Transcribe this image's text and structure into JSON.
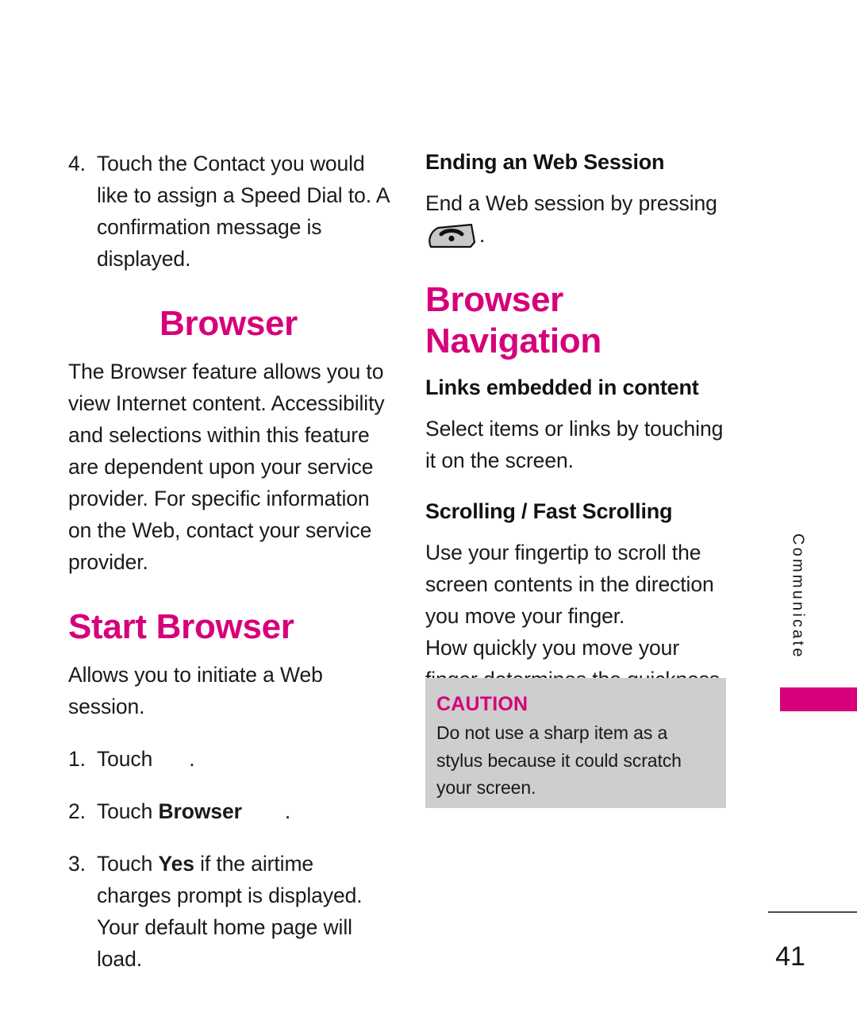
{
  "document": {
    "page_number": "41",
    "side_tab_label": "Communicate",
    "accent_color": "#d6007a",
    "caution_bg_color": "#cecece"
  },
  "left_column": {
    "step4": {
      "number": "4.",
      "text": "Touch the Contact you would like to assign a Speed Dial to. A confirmation message is displayed."
    },
    "browser_title": "Browser",
    "browser_intro": "The Browser feature allows you to view Internet content. Accessibility and selections within this feature are dependent upon your service provider. For specific information on the Web, contact your service provider.",
    "start_browser_title": "Start Browser",
    "start_browser_intro": "Allows you to initiate a Web session.",
    "steps": [
      {
        "number": "1.",
        "prefix": "Touch",
        "bold": "",
        "icon": "menu-key-icon",
        "suffix": "."
      },
      {
        "number": "2.",
        "prefix": "Touch",
        "bold": "Browser",
        "icon": "browser-key-icon",
        "suffix": "."
      },
      {
        "number": "3.",
        "prefix": "Touch",
        "bold": "Yes",
        "icon": "",
        "suffix": "if the airtime charges prompt is displayed. Your default home page will load."
      }
    ]
  },
  "right_column": {
    "ending_session_heading": "Ending an Web Session",
    "ending_session_text_before_icon": "End a Web session by pressing",
    "ending_session_icon": "end-call-key-icon",
    "ending_session_text_after_icon": ".",
    "browser_navigation_title": "Browser Navigation",
    "links_heading": "Links embedded in content",
    "links_text": "Select items or links by touching it on the screen.",
    "scrolling_heading": "Scrolling / Fast Scrolling",
    "scrolling_paragraph_1": "Use your fingertip to scroll the screen contents in the direction you move your finger.",
    "scrolling_paragraph_2": "How quickly you move your finger determines the quickness of the scroll."
  },
  "caution": {
    "title": "CAUTION",
    "text": "Do not use a sharp item as a stylus because it could scratch your screen."
  }
}
